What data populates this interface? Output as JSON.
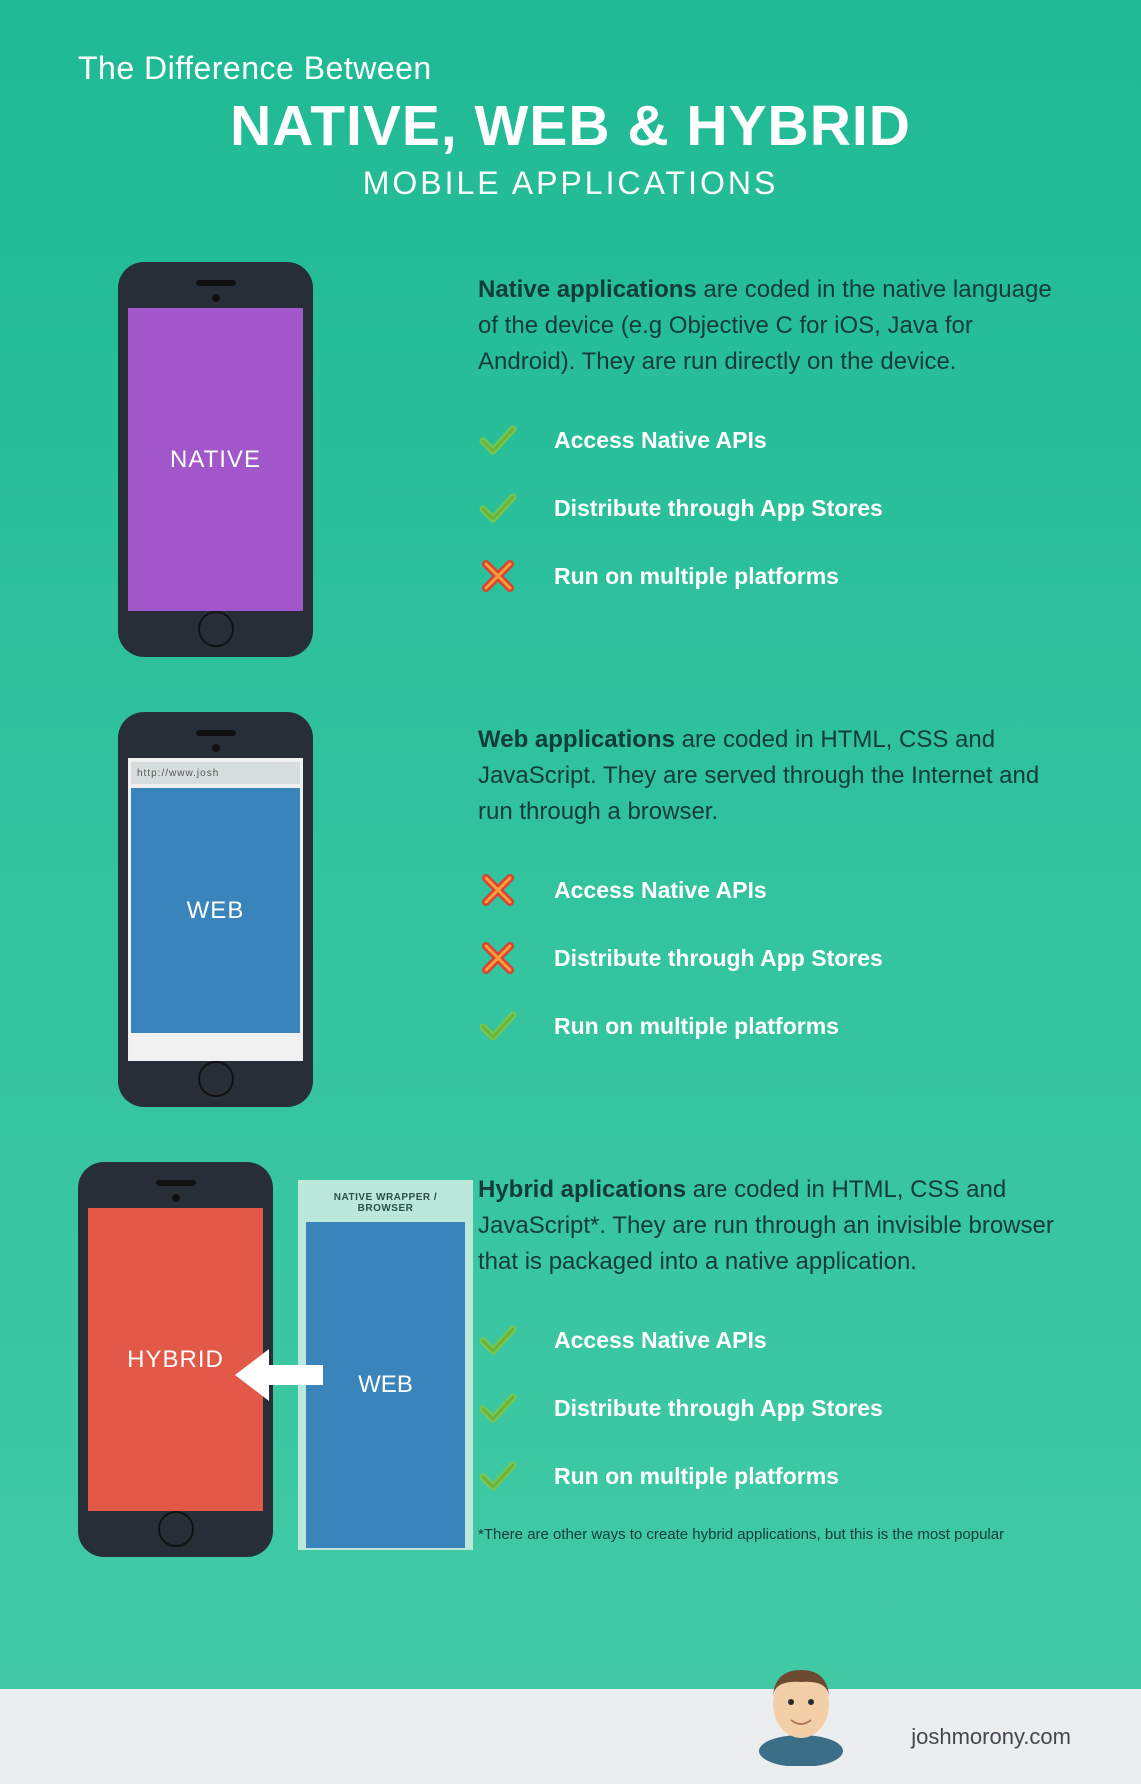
{
  "title": {
    "pretitle": "The Difference Between",
    "main": "NATIVE, WEB & HYBRID",
    "subtitle": "MOBILE APPLICATIONS"
  },
  "sections": [
    {
      "phone_label": "NATIVE",
      "desc_bold": "Native applications",
      "desc_rest": " are coded in the native language of the device (e.g Objective C for iOS, Java for Android). They are run directly on the device.",
      "features": [
        {
          "label": "Access Native APIs",
          "ok": true
        },
        {
          "label": "Distribute through App Stores",
          "ok": true
        },
        {
          "label": "Run on multiple platforms",
          "ok": false
        }
      ]
    },
    {
      "phone_label": "WEB",
      "url": "http://www.josh",
      "desc_bold": "Web applications",
      "desc_rest": " are coded in HTML, CSS and JavaScript. They are served through the Internet and run through a browser.",
      "features": [
        {
          "label": "Access Native APIs",
          "ok": false
        },
        {
          "label": "Distribute through App Stores",
          "ok": false
        },
        {
          "label": "Run on multiple platforms",
          "ok": true
        }
      ]
    },
    {
      "phone_label": "HYBRID",
      "wrapper_label": "NATIVE WRAPPER / BROWSER",
      "wrapper_inner": "WEB",
      "desc_bold": "Hybrid aplications",
      "desc_rest": " are coded in HTML, CSS and JavaScript*.  They are run through an invisible browser that is packaged into a native application.",
      "features": [
        {
          "label": "Access Native APIs",
          "ok": true
        },
        {
          "label": "Distribute through App Stores",
          "ok": true
        },
        {
          "label": "Run on multiple platforms",
          "ok": true
        }
      ],
      "footnote": "*There are other ways to create hybrid applications, but this is the most popular"
    }
  ],
  "footer": {
    "site": "joshmorony.com"
  }
}
